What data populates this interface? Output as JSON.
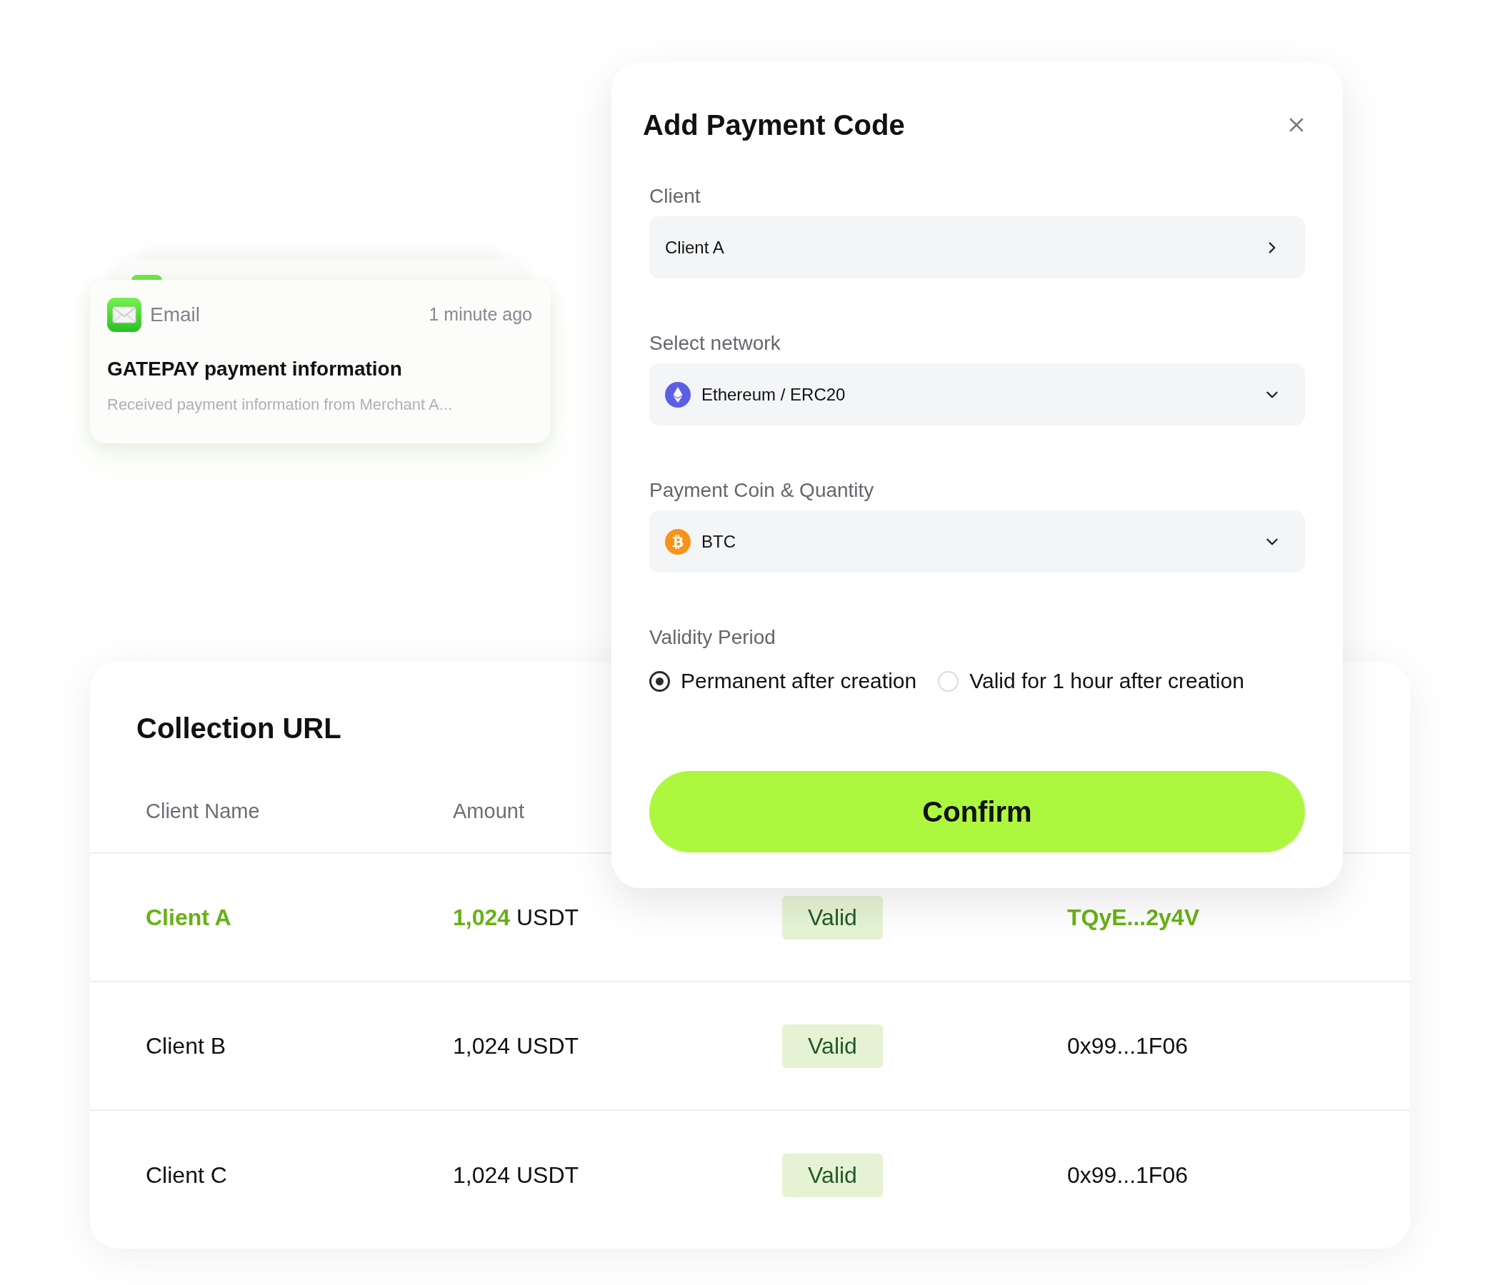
{
  "notification": {
    "app": "Email",
    "time": "1 minute ago",
    "title": "GATEPAY payment information",
    "preview": "Received payment information from Merchant A..."
  },
  "dialog": {
    "title": "Add Payment Code",
    "fields": [
      {
        "kind": "link",
        "label": "Client",
        "value": "Client A"
      },
      {
        "kind": "network",
        "label": "Select network",
        "value": "Ethereum / ERC20"
      },
      {
        "kind": "coin",
        "label": "Payment Coin & Quantity",
        "value": "BTC"
      },
      {
        "kind": "radio",
        "label": "Validity Period",
        "options": [
          {
            "label": "Permanent after creation",
            "selected": true
          },
          {
            "label": "Valid for 1 hour after creation",
            "selected": false
          }
        ]
      }
    ],
    "confirm": "Confirm"
  },
  "table": {
    "title": "Collection URL",
    "columns": [
      "Client Name",
      "Amount"
    ],
    "rows": [
      {
        "client": "Client A",
        "amount": "1,024",
        "unit": "USDT",
        "status": "Valid",
        "address": "TQyE...2y4V",
        "selected": true
      },
      {
        "client": "Client B",
        "amount": "1,024",
        "unit": "USDT",
        "status": "Valid",
        "address": "0x99...1F06",
        "selected": false
      },
      {
        "client": "Client C",
        "amount": "1,024",
        "unit": "USDT",
        "status": "Valid",
        "address": "0x99...1F06",
        "selected": false
      }
    ]
  }
}
